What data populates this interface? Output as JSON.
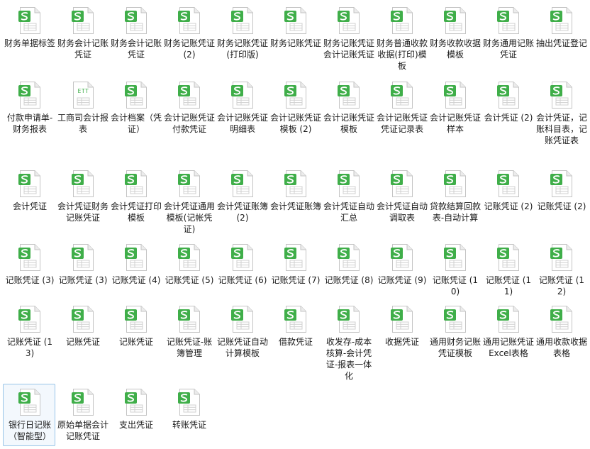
{
  "colors": {
    "sheet_badge": "#3fae49",
    "ett_text": "#3fae49",
    "page_fill": "#ffffff",
    "page_edge": "#c4c4c4",
    "selection_border": "#99c4e8"
  },
  "icons": {
    "sheet": "spreadsheet-file-icon",
    "ett": "ett-template-file-icon"
  },
  "files": [
    {
      "label": "财务单据标签",
      "icon": "sheet"
    },
    {
      "label": "财务会计记账凭证",
      "icon": "sheet"
    },
    {
      "label": "财务会计记账凭证",
      "icon": "sheet"
    },
    {
      "label": "财务记账凭证 (2)",
      "icon": "sheet"
    },
    {
      "label": "财务记账凭证(打印版)",
      "icon": "sheet"
    },
    {
      "label": "财务记账凭证",
      "icon": "sheet"
    },
    {
      "label": "财务记账凭证会计记账凭证",
      "icon": "sheet"
    },
    {
      "label": "财务普通收款收据(打印)模板",
      "icon": "sheet"
    },
    {
      "label": "财务收款收据模板",
      "icon": "sheet"
    },
    {
      "label": "财务通用记账凭证",
      "icon": "sheet"
    },
    {
      "label": "抽出凭证登记",
      "icon": "sheet"
    },
    {
      "label": "付款申请单-财务报表",
      "icon": "sheet"
    },
    {
      "label": "工商司会计报表",
      "icon": "ett",
      "badge_text": "ETT"
    },
    {
      "label": "会计档案（凭证）",
      "icon": "sheet"
    },
    {
      "label": "会计记账凭证付款凭证",
      "icon": "sheet"
    },
    {
      "label": "会计记账凭证明细表",
      "icon": "sheet"
    },
    {
      "label": "会计记账凭证模板 (2)",
      "icon": "sheet"
    },
    {
      "label": "会计记账凭证模板",
      "icon": "sheet"
    },
    {
      "label": "会计记账凭证凭证记录表",
      "icon": "sheet"
    },
    {
      "label": "会计记账凭证样本",
      "icon": "sheet"
    },
    {
      "label": "会计凭证 (2)",
      "icon": "sheet"
    },
    {
      "label": "会计凭证，记账科目表，记账凭证表",
      "icon": "sheet"
    },
    {
      "label": "会计凭证",
      "icon": "sheet"
    },
    {
      "label": "会计凭证财务记账凭证",
      "icon": "sheet"
    },
    {
      "label": "会计凭证打印模板",
      "icon": "sheet"
    },
    {
      "label": "会计凭证通用模板(记帐凭证)",
      "icon": "sheet"
    },
    {
      "label": "会计凭证账簿 (2)",
      "icon": "sheet"
    },
    {
      "label": "会计凭证账簿",
      "icon": "sheet"
    },
    {
      "label": "会计凭证自动汇总",
      "icon": "sheet"
    },
    {
      "label": "会计凭证自动调取表",
      "icon": "sheet"
    },
    {
      "label": "贷款结算回款表-自动计算",
      "icon": "sheet"
    },
    {
      "label": "记账凭证 (2)",
      "icon": "sheet"
    },
    {
      "label": "记账凭证 (2)",
      "icon": "sheet"
    },
    {
      "label": "记账凭证 (3)",
      "icon": "sheet"
    },
    {
      "label": "记账凭证 (3)",
      "icon": "sheet"
    },
    {
      "label": "记账凭证 (4)",
      "icon": "sheet"
    },
    {
      "label": "记账凭证 (5)",
      "icon": "sheet"
    },
    {
      "label": "记账凭证 (6)",
      "icon": "sheet"
    },
    {
      "label": "记账凭证 (7)",
      "icon": "sheet"
    },
    {
      "label": "记账凭证 (8)",
      "icon": "sheet"
    },
    {
      "label": "记账凭证 (9)",
      "icon": "sheet"
    },
    {
      "label": "记账凭证 (10)",
      "icon": "sheet"
    },
    {
      "label": "记账凭证 (11)",
      "icon": "sheet"
    },
    {
      "label": "记账凭证 (12)",
      "icon": "sheet"
    },
    {
      "label": "记账凭证 (13)",
      "icon": "sheet"
    },
    {
      "label": "记账凭证",
      "icon": "sheet"
    },
    {
      "label": "记账凭证",
      "icon": "sheet"
    },
    {
      "label": "记账凭证-账簿管理",
      "icon": "sheet"
    },
    {
      "label": "记账凭证自动计算模板",
      "icon": "sheet"
    },
    {
      "label": "借款凭证",
      "icon": "sheet"
    },
    {
      "label": "收发存-成本核算-会计凭证-报表一体化",
      "icon": "sheet"
    },
    {
      "label": "收据凭证",
      "icon": "sheet"
    },
    {
      "label": "通用财务记账凭证模板",
      "icon": "sheet"
    },
    {
      "label": "通用记账凭证Excel表格",
      "icon": "sheet"
    },
    {
      "label": "通用收款收据表格",
      "icon": "sheet"
    },
    {
      "label": "银行日记账（智能型）",
      "icon": "sheet",
      "selected": true
    },
    {
      "label": "原始单据会计记账凭证",
      "icon": "sheet"
    },
    {
      "label": "支出凭证",
      "icon": "sheet"
    },
    {
      "label": "转账凭证",
      "icon": "sheet"
    }
  ]
}
